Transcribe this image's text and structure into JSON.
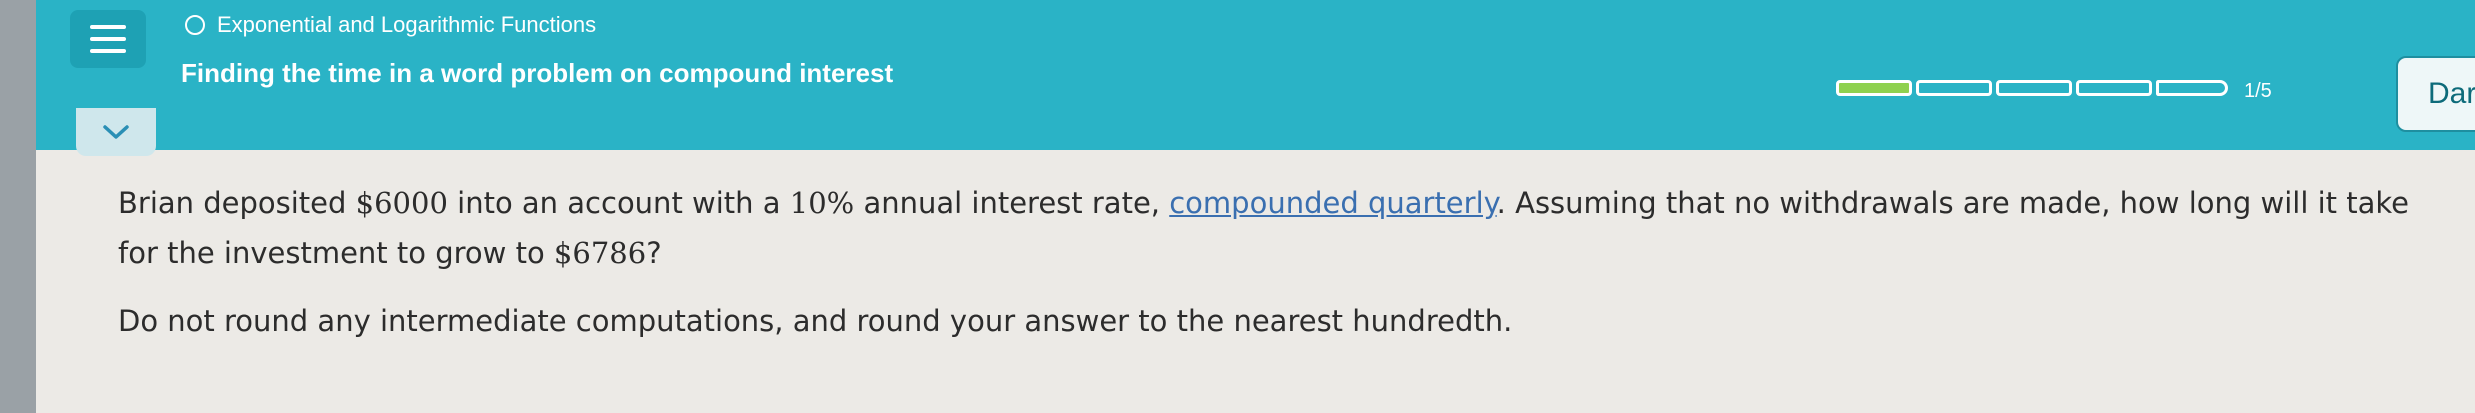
{
  "header": {
    "menu_icon": "hamburger-menu-icon",
    "topic": "Exponential and Logarithmic Functions",
    "title": "Finding the time in a word problem on compound interest",
    "progress": {
      "completed": 1,
      "total_segments": 5,
      "label": "1/5"
    },
    "dark_button_label": "Dar"
  },
  "collapse_icon": "chevron-down-icon",
  "question": {
    "part1_text": "Brian deposited ",
    "amount": "$6000",
    "part2_text": " into an account with a ",
    "rate": "10%",
    "part3_text": " annual interest rate, ",
    "link_text": "compounded quarterly",
    "part4_text": ". Assuming that no withdrawals are made, how long will it take for the investment to grow to ",
    "target": "$6786",
    "part5_text": "?",
    "instruction": "Do not round any intermediate computations, and round your answer to the nearest hundredth."
  },
  "colors": {
    "header": "#2ab3c6",
    "progress_filled": "#8fd14f",
    "link": "#3a6fb0"
  }
}
